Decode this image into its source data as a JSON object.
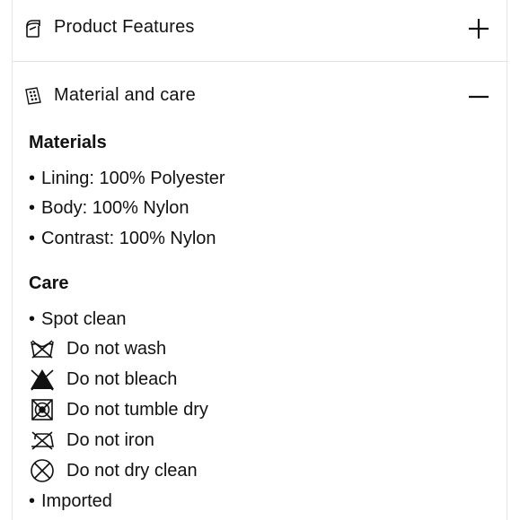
{
  "accordion": {
    "product_features": {
      "title": "Product Features",
      "toggle": "plus-icon"
    },
    "material_care": {
      "title": "Material and care",
      "toggle": "minus-icon"
    }
  },
  "materials": {
    "heading": "Materials",
    "items": [
      "Lining: 100% Polyester",
      "Body: 100% Nylon",
      "Contrast: 100% Nylon"
    ]
  },
  "care": {
    "heading": "Care",
    "items": [
      {
        "text": "Spot clean",
        "icon": "bullet"
      },
      {
        "text": "Do not wash",
        "icon": "do-not-wash-icon"
      },
      {
        "text": "Do not bleach",
        "icon": "do-not-bleach-icon"
      },
      {
        "text": "Do not tumble dry",
        "icon": "do-not-tumble-dry-icon"
      },
      {
        "text": "Do not iron",
        "icon": "do-not-iron-icon"
      },
      {
        "text": "Do not dry clean",
        "icon": "do-not-dry-clean-icon"
      },
      {
        "text": "Imported",
        "icon": "bullet"
      }
    ]
  }
}
